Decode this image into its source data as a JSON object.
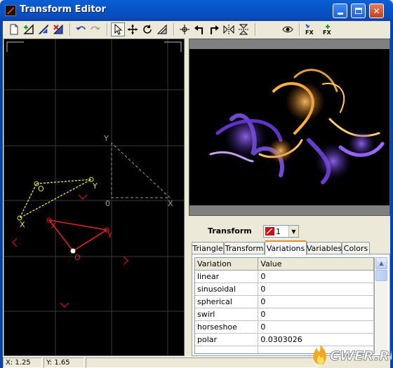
{
  "window": {
    "title": "Transform Editor"
  },
  "toolbar": {
    "buttons": [
      "new-transform-icon",
      "add-transform-icon",
      "duplicate-transform-icon",
      "delete-transform-icon",
      "undo-icon",
      "redo-icon",
      "select-pointer-icon",
      "move-icon",
      "rotate-icon",
      "scale-icon",
      "flip-center-icon",
      "rotate-left-icon",
      "rotate-right-icon",
      "flip-horizontal-icon",
      "flip-vertical-icon",
      "preview-eye-icon",
      "pre-fx-icon",
      "post-fx-icon"
    ]
  },
  "editor": {
    "labels": {
      "origin": "O",
      "x_axis": "X",
      "y_axis": "Y",
      "reference_origin": "0"
    }
  },
  "transform": {
    "label": "Transform",
    "selected_value": "1",
    "swatch_color": "#c01818"
  },
  "tabs": [
    {
      "label": "Triangle",
      "active": false
    },
    {
      "label": "Transform",
      "active": false
    },
    {
      "label": "Variations",
      "active": true
    },
    {
      "label": "Variables",
      "active": false
    },
    {
      "label": "Colors",
      "active": false
    }
  ],
  "variations": {
    "headers": [
      "Variation",
      "Value"
    ],
    "rows": [
      {
        "name": "linear",
        "value": "0"
      },
      {
        "name": "sinusoidal",
        "value": "0"
      },
      {
        "name": "spherical",
        "value": "0"
      },
      {
        "name": "swirl",
        "value": "0"
      },
      {
        "name": "horseshoe",
        "value": "0"
      },
      {
        "name": "polar",
        "value": "0.0303026"
      }
    ]
  },
  "status": {
    "x": "X: 1.25",
    "y": "Y: 1.65"
  },
  "watermark": {
    "text": "CWER.RU"
  },
  "colors": {
    "active_triangle": "#e02020",
    "inactive_triangle": "#e8e040",
    "reference_triangle": "#a0a0a0",
    "accent_tab": "#e68b2c"
  }
}
